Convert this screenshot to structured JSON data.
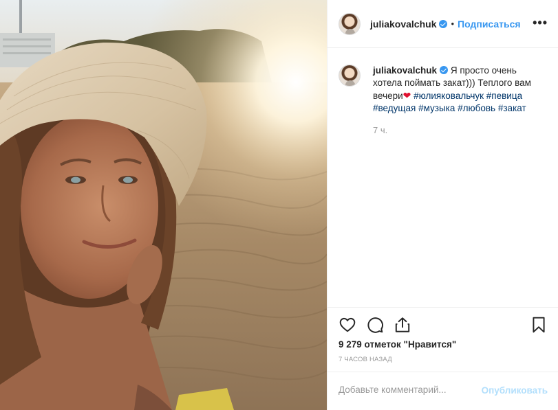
{
  "post": {
    "username": "juliakovalchuk",
    "separator": "•",
    "follow_label": "Подписаться",
    "more_icon": "more-options-icon",
    "more_glyph": "•••"
  },
  "caption": {
    "username": "juliakovalchuk",
    "text_part1": "Я просто очень хотела поймать закат))) Теплого вам вечери",
    "heart": "❤",
    "hashtags": [
      "#юлияковальчук",
      "#певица",
      "#ведущая",
      "#музыка",
      "#любовь",
      "#закат"
    ],
    "time_ago": "7 ч."
  },
  "actions": {
    "like_icon": "heart-icon",
    "comment_icon": "comment-icon",
    "share_icon": "share-icon",
    "save_icon": "bookmark-icon"
  },
  "likes_text": "9 279 отметок \"Нравится\"",
  "posted_ago": "7 ЧАСОВ НАЗАД",
  "comment": {
    "placeholder": "Добавьте комментарий...",
    "value": "",
    "publish_label": "Опубликовать"
  },
  "colors": {
    "accent": "#3897f0",
    "hashtag": "#003569",
    "muted": "#999999",
    "publish_disabled": "#b2dffc",
    "heart_red": "#e0102f",
    "border": "#efefef"
  }
}
